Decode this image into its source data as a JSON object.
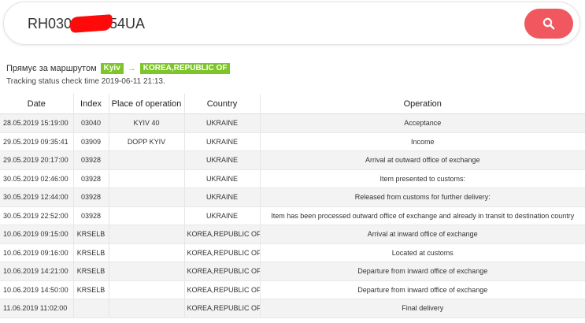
{
  "search": {
    "value_prefix": "RH030",
    "value_suffix": "54UA",
    "button_icon": "search-icon"
  },
  "route": {
    "label": "Прямує за маршрутом",
    "from": "Kyiv",
    "arrow": "→",
    "to": "KOREA,REPUBLIC OF"
  },
  "check_time": "Tracking status check time 2019-06-11 21:13.",
  "colors": {
    "accent_red": "#f0575e",
    "badge_green": "#7ec52a"
  },
  "table": {
    "headers": [
      "Date",
      "Index",
      "Place of operation",
      "Country",
      "Operation"
    ],
    "rows": [
      [
        "28.05.2019 15:19:00",
        "03040",
        "KYIV 40",
        "UKRAINE",
        "Acceptance"
      ],
      [
        "29.05.2019 09:35:41",
        "03909",
        "DOPP KYIV",
        "UKRAINE",
        "Income"
      ],
      [
        "29.05.2019 20:17:00",
        "03928",
        "",
        "UKRAINE",
        "Arrival at outward office of exchange"
      ],
      [
        "30.05.2019 02:46:00",
        "03928",
        "",
        "UKRAINE",
        "Item presented to customs:"
      ],
      [
        "30.05.2019 12:44:00",
        "03928",
        "",
        "UKRAINE",
        "Released from customs for further delivery:"
      ],
      [
        "30.05.2019 22:52:00",
        "03928",
        "",
        "UKRAINE",
        "Item has been processed outward office of exchange and already in transit to destination country"
      ],
      [
        "10.06.2019 09:15:00",
        "KRSELB",
        "",
        "KOREA,REPUBLIC OF",
        "Arrival at inward office of exchange"
      ],
      [
        "10.06.2019 09:16:00",
        "KRSELB",
        "",
        "KOREA,REPUBLIC OF",
        "Located at customs"
      ],
      [
        "10.06.2019 14:21:00",
        "KRSELB",
        "",
        "KOREA,REPUBLIC OF",
        "Departure from inward office of exchange"
      ],
      [
        "10.06.2019 14:50:00",
        "KRSELB",
        "",
        "KOREA,REPUBLIC OF",
        "Departure from inward office of exchange"
      ],
      [
        "11.06.2019 11:02:00",
        "",
        "",
        "KOREA,REPUBLIC OF",
        "Final delivery"
      ]
    ]
  }
}
